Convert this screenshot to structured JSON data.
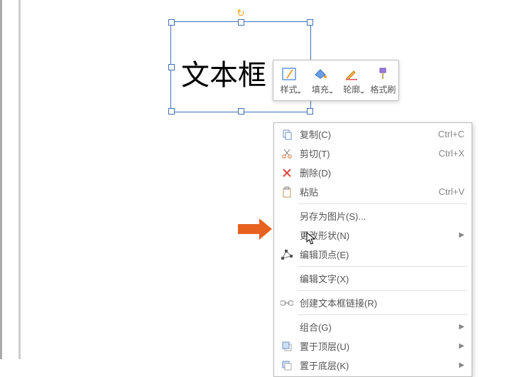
{
  "textbox": {
    "text": "文本框"
  },
  "toolbar": {
    "style": "样式",
    "fill": "填充",
    "outline": "轮廓",
    "format_painter": "格式刷"
  },
  "menu": {
    "copy": {
      "label": "复制(C)",
      "shortcut": "Ctrl+C"
    },
    "cut": {
      "label": "剪切(T)",
      "shortcut": "Ctrl+X"
    },
    "delete": {
      "label": "删除(D)"
    },
    "paste": {
      "label": "粘贴",
      "shortcut": "Ctrl+V"
    },
    "save_as_picture": {
      "label": "另存为图片(S)..."
    },
    "change_shape": {
      "label": "更改形状(N)"
    },
    "edit_vertices": {
      "label": "编辑顶点(E)"
    },
    "edit_text": {
      "label": "编辑文字(X)"
    },
    "create_link": {
      "label": "创建文本框链接(R)"
    },
    "group": {
      "label": "组合(G)"
    },
    "bring_front": {
      "label": "置于顶层(U)"
    },
    "send_back": {
      "label": "置于底层(K)"
    }
  }
}
